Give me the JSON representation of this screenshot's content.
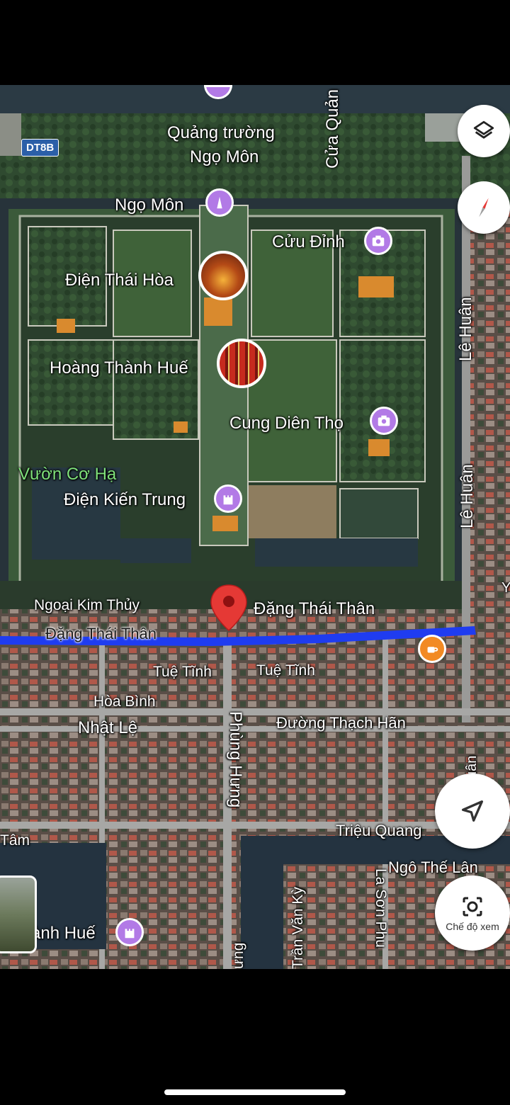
{
  "colors": {
    "route": "#1f3cf0",
    "poi_purple": "#b27ae6",
    "cafe_orange": "#f28a23",
    "marker_red": "#e53935"
  },
  "shield": "DT8B",
  "labels": {
    "quang_truong_1": "Quảng trường",
    "quang_truong_2": "Ngọ Môn",
    "ngo_mon": "Ngọ Môn",
    "cua_quang": "Cửa Quản",
    "cuu_dinh": "Cửu Đỉnh",
    "dien_thai_hoa": "Điện Thái Hòa",
    "hoang_thanh_hue": "Hoàng Thành Huế",
    "cung_dien_tho": "Cung Diên Thọ",
    "vuon_co_ha": "Vườn Cơ Hạ",
    "dien_kien_trung": "Điện Kiến Trung",
    "le_huan_1": "Lê Huân",
    "le_huan_2": "Lê Huân",
    "ngoai_kim_thuy": "Ngoại Kim Thủy",
    "dang_thai_than_pin": "Đặng Thái Thân",
    "dang_thai_than_road": "Đặng Thái Thân",
    "tue_tinh_1": "Tuệ Tĩnh",
    "tue_tinh_2": "Tuệ Tĩnh",
    "hoa_binh": "Hòa Bình",
    "nhat_le": "Nhật Lệ",
    "phung_hung": "Phùng Hưng",
    "duong_thach_han": "Đường Thạch Hãn",
    "trieu_quang": "Triệu Quang",
    "ngo_the_lan": "Ngô Thế Lân",
    "tran_van_ky": "Trần Văn Kỳ",
    "la_son_phu": "La Sơn Phu",
    "tam_partial": "Tâm",
    "thanh_hue_partial": "ành Huế",
    "hung_partial": "ưng",
    "huan_partial": "uân",
    "y_partial": "Y"
  },
  "icons": {
    "layers": "layers-icon",
    "compass": "compass-icon",
    "navigate": "navigation-arrow-icon",
    "lens": "camera-lens-icon",
    "pagoda": "pagoda-icon",
    "camera": "camera-icon",
    "castle": "castle-icon",
    "coffee": "coffee-icon",
    "marker": "map-marker-icon"
  },
  "buttons": {
    "view_mode": "Chế độ xem"
  }
}
